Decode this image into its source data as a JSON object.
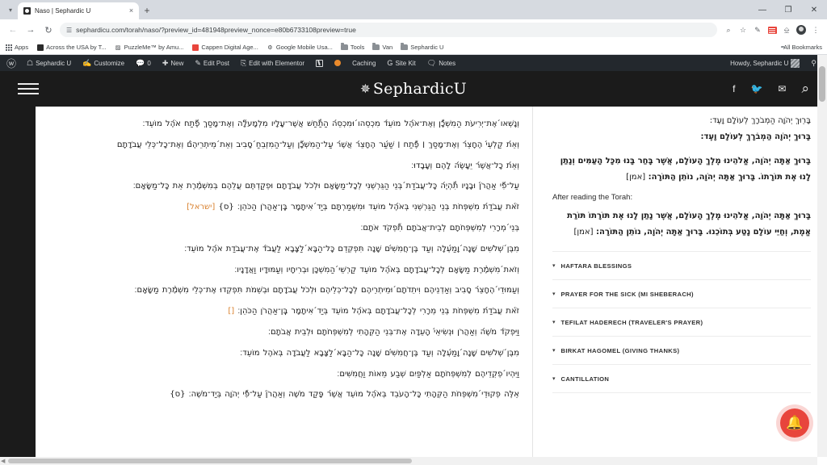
{
  "browser": {
    "tab": {
      "title": "Naso | Sephardic U",
      "favicon_name": "site-favicon",
      "close_label": "×"
    },
    "new_tab_label": "+",
    "tabstrip_chevron": "▾",
    "window_controls": {
      "minimize": "—",
      "maximize": "❐",
      "close": "✕"
    },
    "nav": {
      "back": "←",
      "forward": "→",
      "reload": "↻"
    },
    "omnibox": {
      "url": "sephardicu.com/torah/naso/?preview_id=481948preview_nonce=e80b6733108preview=true",
      "placeholder": "Search Google or type a URL",
      "site_settings_icon": "tune-icon"
    },
    "toolbar_icons": [
      "zoom-icon",
      "bookmark-star-icon",
      "extension-pen-icon",
      "extension-red-icon",
      "extension-outline-icon",
      "profile-avatar-icon",
      "three-dot-menu-icon"
    ],
    "bookmarks": [
      {
        "label": "Apps",
        "icon": "apps-grid-icon"
      },
      {
        "label": "Across the USA by T...",
        "icon": "square-dark-icon"
      },
      {
        "label": "PuzzleMe™ by Amu...",
        "icon": "puzzle-icon"
      },
      {
        "label": "Cappen Digital Age...",
        "icon": "square-red-icon"
      },
      {
        "label": "Google Mobile Usa...",
        "icon": "site-icon"
      },
      {
        "label": "Tools",
        "icon": "folder-icon"
      },
      {
        "label": "Van",
        "icon": "folder-icon"
      },
      {
        "label": "Sephardic U",
        "icon": "folder-icon"
      }
    ],
    "all_bookmarks_label": "All Bookmarks"
  },
  "wp_admin_bar": {
    "logo_glyph": "ⓦ",
    "items": [
      {
        "label": "Sephardic U",
        "icon": "dashboard-home-icon"
      },
      {
        "label": "Customize",
        "icon": "paintbrush-icon"
      },
      {
        "label": "0",
        "icon": "comment-bubble-icon"
      },
      {
        "label": "New",
        "icon": "plus-icon"
      },
      {
        "label": "Edit Post",
        "icon": "pencil-icon"
      },
      {
        "label": "Edit with Elementor",
        "icon": "elementor-icon"
      },
      {
        "label": "",
        "icon": "yoast-seo-icon"
      },
      {
        "label": "",
        "icon": "orange-dot-icon"
      },
      {
        "label": "Caching",
        "icon": "caching-icon"
      },
      {
        "label": "Site Kit",
        "icon": "google-g-icon"
      },
      {
        "label": "Notes",
        "icon": "notes-bubble-icon"
      }
    ],
    "howdy": "Howdy, Sephardic U",
    "search_icon": "search-icon"
  },
  "site_header": {
    "menu_icon": "hamburger-menu-icon",
    "brand_mark": "✵",
    "brand_text": "SephardicU",
    "icons": [
      {
        "name": "facebook-icon",
        "glyph": "f"
      },
      {
        "name": "twitter-icon",
        "glyph": "🐦"
      },
      {
        "name": "email-icon",
        "glyph": "✉"
      },
      {
        "name": "search-icon",
        "glyph": "⌕"
      }
    ]
  },
  "main": {
    "lines": [
      {
        "text": "וְנָשְׁאו́ אֶת־יְרִיעֹת הַמִשְׁכָّן וְאֶת־אֹ́הֶל מוֹעֵ́ד מִכְסֵהו́ וּמִכְסֵ́ה הַתַّחַשׁ אֲשֶׁר־עָלָיו מִלְמָע̆לָה וְאֶת־מָסַךְ פֶّתַח אֹ́הֶל מוֹעֵד׃",
        "highlight": null
      },
      {
        "text": "וְאֵ́ת קַלְעֵ́י הֶחָצֵ́ר וְאֶת־מָסַךְ ׀ פֶّתַח ׀ שַׁ́עַר הֶחָצֵ́ר אֲשֶׁ́ר עַל־הַמִשְׁכָّן וְעַל־הַמִזְבֵחַ́ סָבִיב וְאֵת́ מֵיתְרֵיהֶ̂ם וְאֶת־כָל־כְּלֵי עֲבֹדָתָם",
        "highlight": null
      },
      {
        "text": "וְאֵ́ת כָל־אֲשֶׁ́ר יֵעָשֶׂ́ה לָהֶם וְעָבָדוּ׃",
        "highlight": null
      },
      {
        "text": "עַל־פִّי אַהֲרֹ́ן וּבָנָיו תִّהְיֶ́ה כָּל־עֲבֹדַת́ בְּנֵי הַגֵּרְשְׁנִּי לְכָל־מַשָּׂאָם וּלְכֹל עֲבֹדָתָם וּפְקַדְתֶּם עֲלֵהֶם בְּמִשְׁמֶ֨רֶת אֵת כָּל־מַשָּׂאָם׃",
        "highlight": null
      },
      {
        "text": "זֹ́את עֲבֹדַ́ת מִשְׁפְּחֹת בְּנֵי הַגֵּרְשְׁנִּי בְּאֹ́הֶל מוֹעֵד וּמִשְׁמַרְתָּם בְּיַד́ אִיתָמָר בֶּֽן־אַהֲרֹן הַכֹּהֵן׃",
        "trail_brace": "{ס}",
        "highlight": "[ישראל]"
      },
      {
        "text": "בְּנֵי́ מְרָרִי לְמִשְׁפְּחֹתָם לְבֵית־אֲבֹתָם תִّפְקֹד אֹתָם׃",
        "highlight": null
      },
      {
        "text": "מִבֶּן́ שְׁלֹשִׁים שָׁנָה́ וָמַ́עְלָה וְעַד בֶּן־חֲמִשִׁ́ים שָׁנָה תִּפְקְדֵם כָּל־הַבָּא́ לַצָּבָא לַעֲבֹ́ד אֶת־עֲבֹדַת אֹ́הֶל מוֹעֵד׃",
        "highlight": null
      },
      {
        "text": "וְזֹאת́ מִשְׁמֶ֨רֶת מַשָּׂאָם לְכָל־עֲבֹדָתָם בְּאֹ́הֶל מוֹעֵד קַרְשֵׁי́ הַמִשְׁכָּן וּבְרִיחָיו וְעַמּוּדָיו וַאֲדָנָיו׃",
        "highlight": null
      },
      {
        "text": "וְעַמּוּדֵי́ הֶחָצֵ́ר סָבִיב וְאַדְנֵיהֶם וִיתֵדֹתָם́ וּמֵיתְרֵיהֶם לְכָל־כְּלֵיהֶם וּלְכֹל עֲבֹדָתָם וּבְשֵׁמֹת תִּפְקְדוּ אֶת־כְּלֵי מִשְׁמֶ֨רֶת מַשָּׂאָם׃",
        "highlight": null
      },
      {
        "text": "זֹ́את עֲבֹדַ́ת מִשְׁפְּחֹת בְּנֵי מְרָרִי לְכָל־עֲבֹדָתָם בְּאֹ́הֶל מוֹעֵד בְּיַד́ אִיתָמָר בֶּֽן־אַהֲרֹן הַכֹּהֵן׃",
        "highlight": "[]"
      },
      {
        "text": "וַיִּפְקֹ́ד מֹשֶׁ́ה וְאַהֲרֹן וּנְשִׂיאֵ́י הָעֵדָה אֶת־בְּנֵי הַקְּהָתִי לְמִשְׁפְּחֹתָם וּלְבֵית אֲבֹתָם׃",
        "highlight": null
      },
      {
        "text": "מִבֶּן́ שְׁלֹשִׁים שָׁנָה́ וָמַ́עְלָה וְעַד בֶּן־חֲמִשִׁ́ים שָׁנָה כָּל־הַבָּא́ לַצָּבָא לַעֲבֹדָה בְּאֹהֶל מוֹעֵד׃",
        "highlight": null
      },
      {
        "text": "וַיִּהְיו́ פְקֻדֵיהֶם לְמִשְׁפְּחֹתָם אַלְפַּיִם שְׁבַע מֵאוֹת וַחֲמִשִּׁים׃",
        "highlight": null
      },
      {
        "text": "אֵלֶּה פְקוּדֵי́ מִשְׁפְּחֹת הַקְּהָתִי כָּל־הָעֹבֵד בְּאֹ́הֶל מוֹעֵד אֲשֶׁ́ר פָּקַד מֹשֶׁה וְאַהֲרֹ́ן עַל־פִّי יְהֹוָה בְּיַד־מֹשֶׁה׃",
        "trail_brace": "{ס}",
        "highlight": null
      }
    ]
  },
  "sidebar": {
    "blessing_top_plain": "בָּרְוּךְ יְהֹוָה הַמְבֹרָךְ לְעוֹלָם וָעֶד:",
    "blessing_top_bold": "בָּרוּךְ יְהֹוָה הַמְבֹרָךְ לְעוֹלָם וָעֶד:",
    "blessing_before": "בָּרוּךְ אַתָּה יְהֹוָה, אֱלֹהֵינוּ מֶלֶךְ הָעוֹלָם, אֲשֶׁר בָּחַר בָּנוּ מִכָּל הָעַמִּים וְנָתַן לָנוּ אֶת תּוֹרָתוֹ. בָּרוּךְ אַתָּה יְהֹוָה, נוֹתֵן הַתּוֹרָה:",
    "amen": "[אמן]",
    "after_label": "After reading the Torah:",
    "blessing_after": "בָּרוּךְ אַתָּה יְהֹוָה, אֱלֹהֵינוּ מֶלֶךְ הָעוֹלָם, אֲשֶׁר נָתַן לָנוּ אֶת תּוֹרָתוֹ תּוֹרַת אֱמֶת, וְחַיֵּי עוֹלָם נָטַע בְּתוֹכֵנוּ. בָּרוּךְ אַתָּה יְהֹוָה, נוֹתֵן הַתּוֹרָה:",
    "accordions": [
      {
        "label": "Haftara Blessings",
        "caret": "▾"
      },
      {
        "label": "Prayer for the Sick (Mi Sheberach)",
        "caret": "▾"
      },
      {
        "label": "Tefilat Haderech (Traveler's Prayer)",
        "caret": "▾"
      },
      {
        "label": "Birkat Hagomel (Giving Thanks)",
        "caret": "▾"
      },
      {
        "label": "Cantillation",
        "caret": "▾"
      }
    ]
  },
  "notification_bell": {
    "icon": "bell-icon",
    "glyph": "🔔"
  },
  "colors": {
    "accent_orange": "#d9812e",
    "header_dark": "#1b1b1b",
    "wp_bar": "#23282d",
    "bell_red": "#e8453c"
  }
}
